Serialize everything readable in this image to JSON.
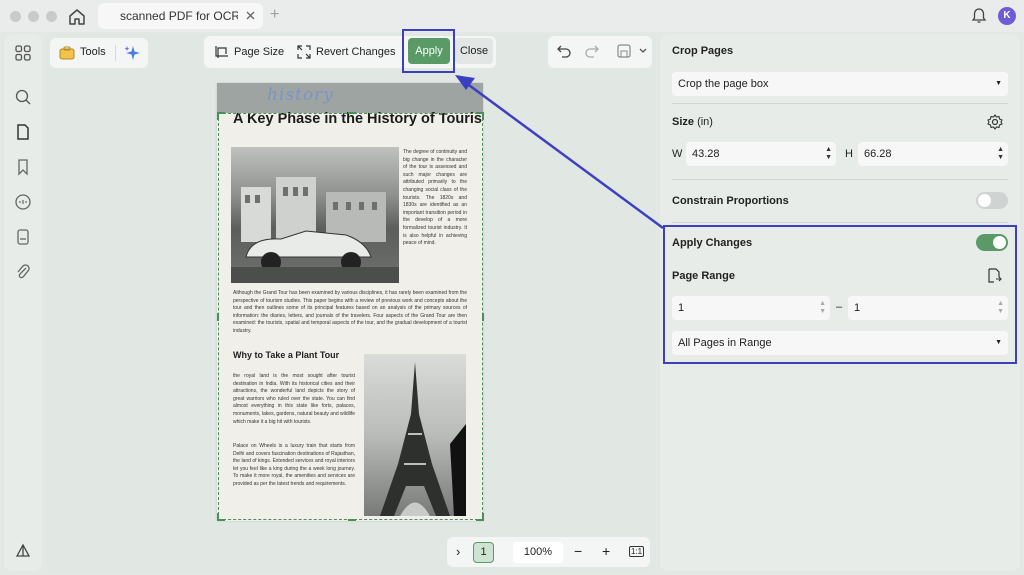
{
  "window": {
    "tab_title": "scanned PDF for OCR test",
    "new_tab": "+",
    "user_initial": "K"
  },
  "toolbar": {
    "tools_label": "Tools",
    "page_size_label": "Page Size",
    "revert_label": "Revert Changes",
    "apply_label": "Apply",
    "close_label": "Close"
  },
  "document": {
    "handwriting": "history",
    "heading": "A Key Phase in the History of Tourism",
    "para_right": "The degree of continuity and big change in the character of the tour is assessed and such major changes are attributed primarily to the changing social class of the tourists. The 1820s and 1830s are identified as an important transition period in the develop of a more formalized tourist industry. It is also helpful in achieving peace of mind.",
    "para_full": "Although the Grand Tour has been examined by various disciplines, it has rarely been examined from the perspective of tourism studies. This paper begins with a review of previous work and concepts about the tour and then outlines some of its principal features based on an analysis of the primary sources of information: the diaries, letters, and journals of the travelers. Four aspects of the Grand Tour are then examined: the tourists, spatial and temporal aspects of the tour, and the gradual development of a tourist industry.",
    "subheading": "Why to Take a Plant Tour",
    "para_left1": "the royal land is the most sought after tourist destination in India. With its historical cities and their attractions, the wonderful land depicts the story of great warriors who ruled over the state. You can find almost everything in this state like forts, palaces, monuments, lakes, gardens, natural beauty and wildlife which make it a big hit with tourists.",
    "para_left2": "Palace on Wheels is a luxury train that starts from Delhi and covers fascination destinations of Rajasthan, the land of kings. Extended services and royal interiors let you feel like a king during the a week long journey. To make it more royal, the amenities and services are provided as per the latest trends and requirements."
  },
  "page_nav": {
    "prev": "›",
    "page": "1",
    "zoom": "100%",
    "zoom_out": "−",
    "zoom_in": "+",
    "fit": "1:1"
  },
  "panel": {
    "crop_pages_label": "Crop Pages",
    "crop_mode": "Crop the page box",
    "size_label": "Size",
    "size_unit": "(in)",
    "w_label": "W",
    "w_value": "43.28",
    "h_label": "H",
    "h_value": "66.28",
    "constrain_label": "Constrain Proportions",
    "constrain_on": false,
    "apply_changes_label": "Apply Changes",
    "apply_changes_on": true,
    "page_range_label": "Page Range",
    "range_from": "1",
    "range_sep": "–",
    "range_to": "1",
    "range_mode": "All Pages in Range"
  },
  "colors": {
    "accent": "#5a9a66",
    "annotation": "#3b3fc2"
  }
}
